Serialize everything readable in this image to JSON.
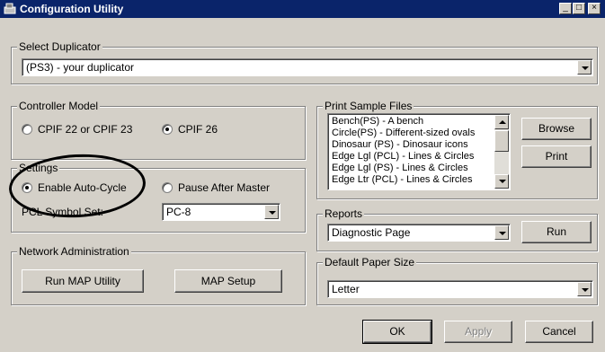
{
  "window": {
    "title": "Configuration Utility",
    "minimize": "_",
    "maximize": "□",
    "close": "×"
  },
  "select_duplicator": {
    "legend": "Select Duplicator",
    "value": "(PS3) - your duplicator"
  },
  "controller_model": {
    "legend": "Controller Model",
    "options": [
      {
        "label": "CPIF 22 or CPIF 23",
        "selected": false
      },
      {
        "label": "CPIF 26",
        "selected": true
      }
    ]
  },
  "settings": {
    "legend": "Settings",
    "options": [
      {
        "label": "Enable Auto-Cycle",
        "selected": true
      },
      {
        "label": "Pause After Master",
        "selected": false
      }
    ],
    "pcl_label": "PCL Symbol Set:",
    "pcl_value": "PC-8"
  },
  "network_admin": {
    "legend": "Network Administration",
    "run_map": "Run MAP Utility",
    "map_setup": "MAP Setup"
  },
  "print_samples": {
    "legend": "Print Sample Files",
    "items": [
      "Bench(PS) - A bench",
      "Circle(PS) - Different-sized ovals",
      "Dinosaur (PS) - Dinosaur icons",
      "Edge Lgl (PCL) - Lines & Circles",
      "Edge Lgl (PS) - Lines & Circles",
      "Edge Ltr (PCL) - Lines & Circles"
    ],
    "browse": "Browse",
    "print": "Print"
  },
  "reports": {
    "legend": "Reports",
    "value": "Diagnostic Page",
    "run": "Run"
  },
  "paper_size": {
    "legend": "Default Paper Size",
    "value": "Letter"
  },
  "footer": {
    "ok": "OK",
    "apply": "Apply",
    "cancel": "Cancel"
  }
}
